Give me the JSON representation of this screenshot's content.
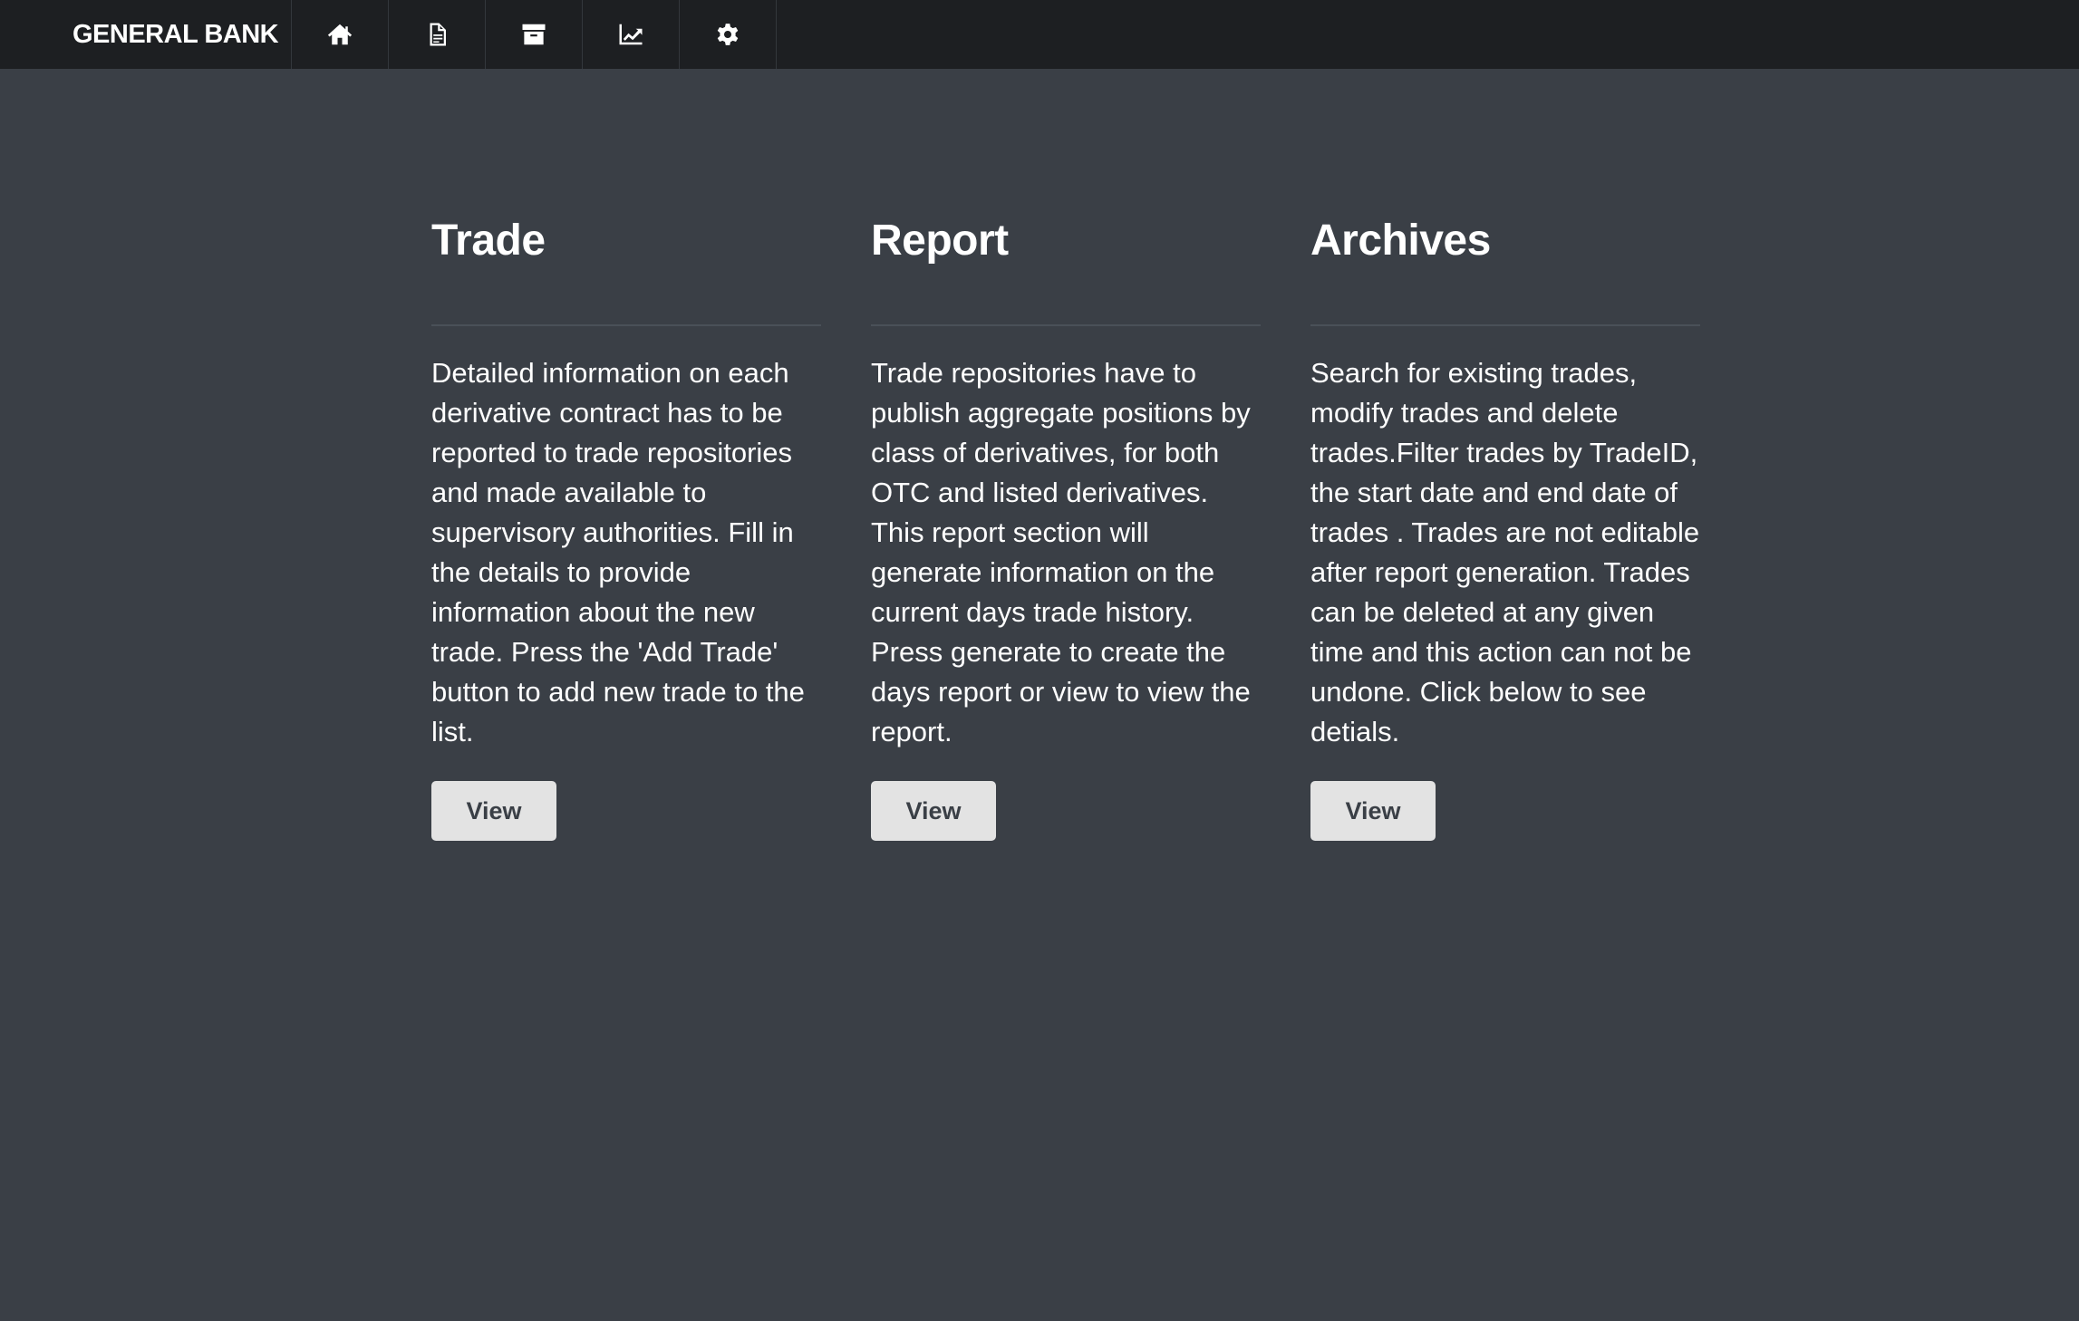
{
  "nav": {
    "brand": "GENERAL BANK",
    "items": [
      {
        "icon": "home-icon"
      },
      {
        "icon": "document-icon"
      },
      {
        "icon": "archive-icon"
      },
      {
        "icon": "chart-icon"
      },
      {
        "icon": "gear-icon"
      }
    ]
  },
  "sections": [
    {
      "title": "Trade",
      "description": "Detailed information on each derivative contract has to be reported to trade repositories and made available to supervisory authorities. Fill in the details to provide information about the new trade. Press the 'Add Trade' button to add new trade to the list.",
      "button_label": "View"
    },
    {
      "title": "Report",
      "description": "Trade repositories have to publish aggregate positions by class of derivatives, for both OTC and listed derivatives. This report section will generate information on the current days trade history. Press generate to create the days report or view to view the report.",
      "button_label": "View"
    },
    {
      "title": "Archives",
      "description": "Search for existing trades, modify trades and delete trades.Filter trades by TradeID, the start date and end date of trades . Trades are not editable after report generation. Trades can be deleted at any given time and this action can not be undone. Click below to see detials.",
      "button_label": "View"
    }
  ],
  "colors": {
    "navbar": "#1d1f22",
    "background": "#3a3f46",
    "button": "#e3e3e3"
  }
}
